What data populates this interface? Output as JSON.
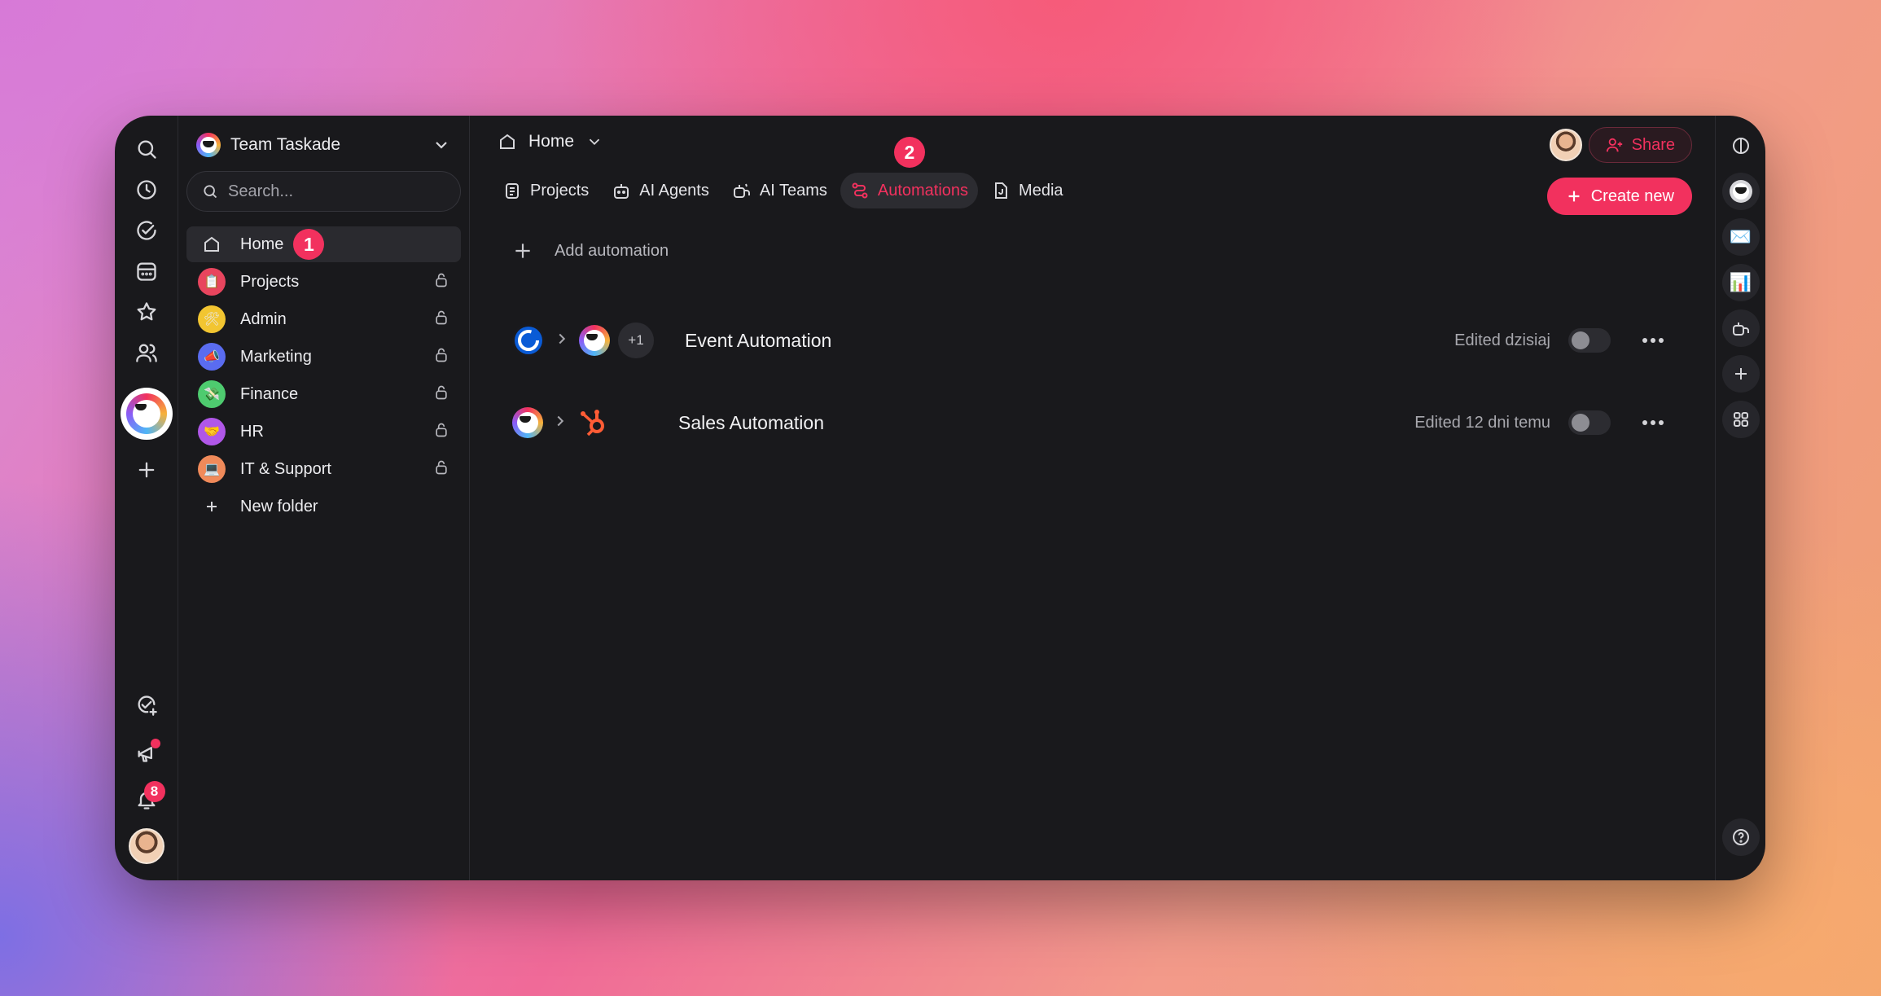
{
  "sidebar": {
    "team_name": "Team Taskade",
    "search_placeholder": "Search...",
    "items": [
      {
        "label": "Home",
        "badge": "1"
      },
      {
        "label": "Projects"
      },
      {
        "label": "Admin"
      },
      {
        "label": "Marketing"
      },
      {
        "label": "Finance"
      },
      {
        "label": "HR"
      },
      {
        "label": "IT & Support"
      },
      {
        "label": "New folder"
      }
    ]
  },
  "rail": {
    "notification_count": "8"
  },
  "header": {
    "breadcrumb": "Home",
    "share_label": "Share",
    "create_label": "Create new"
  },
  "tabs": [
    {
      "label": "Projects"
    },
    {
      "label": "AI Agents"
    },
    {
      "label": "AI Teams"
    },
    {
      "label": "Automations",
      "badge": "2"
    },
    {
      "label": "Media"
    }
  ],
  "automations": {
    "add_label": "Add automation",
    "rows": [
      {
        "title": "Event Automation",
        "extra_count": "+1",
        "edited": "Edited dzisiaj",
        "enabled": false
      },
      {
        "title": "Sales Automation",
        "edited": "Edited 12 dni temu",
        "enabled": false
      }
    ]
  },
  "colors": {
    "accent": "#f2315e",
    "window_bg": "#19191c"
  }
}
